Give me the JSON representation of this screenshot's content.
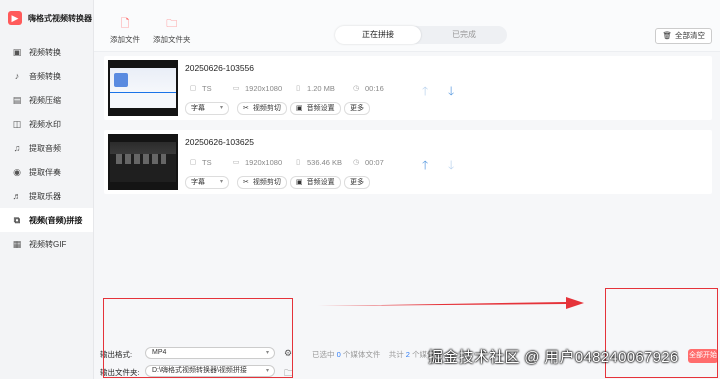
{
  "app": {
    "title": "嗨格式视频转换器"
  },
  "sidebar": {
    "items": [
      {
        "label": "视频转换",
        "icon": "video-convert-icon"
      },
      {
        "label": "音频转换",
        "icon": "audio-convert-icon"
      },
      {
        "label": "视频压缩",
        "icon": "video-compress-icon"
      },
      {
        "label": "视频水印",
        "icon": "watermark-icon"
      },
      {
        "label": "提取音频",
        "icon": "extract-audio-icon"
      },
      {
        "label": "提取伴奏",
        "icon": "extract-accompaniment-icon"
      },
      {
        "label": "提取乐器",
        "icon": "instrument-icon"
      },
      {
        "label": "视频(音频)拼接",
        "icon": "merge-icon"
      },
      {
        "label": "视频转GIF",
        "icon": "gif-icon"
      }
    ],
    "active_index": 7
  },
  "toolbar": {
    "add_file": "添加文件",
    "add_folder": "添加文件夹",
    "clear_all": "全部清空"
  },
  "tabs": [
    {
      "label": "正在拼接",
      "active": true
    },
    {
      "label": "已完成",
      "active": false
    }
  ],
  "files": [
    {
      "name": "20250626-103556",
      "format": "TS",
      "resolution": "1920x1080",
      "size": "1.20 MB",
      "duration": "00:16",
      "subtitle": "字幕",
      "clip": "视频剪切",
      "audio": "音频设置",
      "more": "更多"
    },
    {
      "name": "20250626-103625",
      "format": "TS",
      "resolution": "1920x1080",
      "size": "536.46 KB",
      "duration": "00:07",
      "subtitle": "字幕",
      "clip": "视频剪切",
      "audio": "音频设置",
      "more": "更多"
    }
  ],
  "bottom": {
    "format_label": "输出格式:",
    "format_value": "MP4",
    "folder_label": "输出文件夹:",
    "folder_value": "D:\\嗨格式视频转换器\\视频拼接",
    "selected_prefix": "已选中",
    "selected_count": "0",
    "selected_suffix": "个媒体文件",
    "total_prefix": "共计",
    "total_count": "2",
    "total_suffix": "个媒体",
    "start_button": "全部开始"
  },
  "watermark": "掘金技术社区 @ 用户048240067926",
  "colors": {
    "accent": "#ff5a5a",
    "annotation_red": "#e5333a",
    "link_blue": "#2f7cf6"
  }
}
